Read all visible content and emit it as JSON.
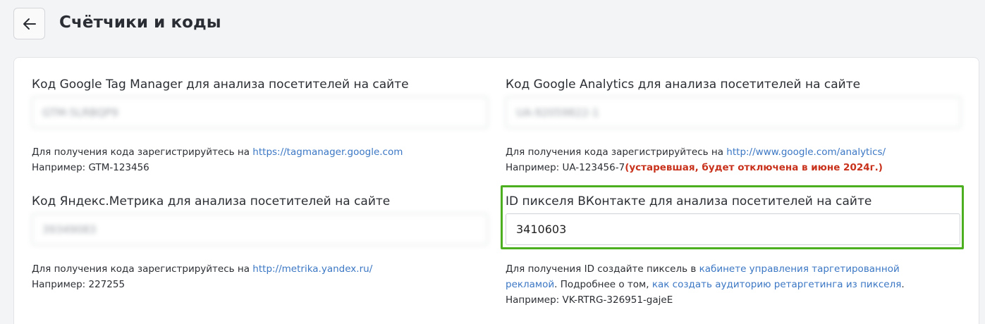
{
  "header": {
    "title": "Счётчики и коды"
  },
  "fields": {
    "gtm": {
      "label": "Код Google Tag Manager для анализа посетителей на сайте",
      "value": "GTM-5LRBQP9",
      "hint_prefix": "Для получения кода зарегистрируйтесь на ",
      "hint_link": "https://tagmanager.google.com",
      "example": "Например: GTM-123456"
    },
    "ga": {
      "label": "Код Google Analytics для анализа посетителей на сайте",
      "value": "UA-92059822-1",
      "hint_prefix": "Для получения кода зарегистрируйтесь на ",
      "hint_link": "http://www.google.com/analytics/",
      "example": "Например: UA-123456-7",
      "warning": "(устаревшая, будет отключена в июне 2024г.)"
    },
    "yandex": {
      "label": "Код Яндекс.Метрика для анализа посетителей на сайте",
      "value": "39349083",
      "hint_prefix": "Для получения кода зарегистрируйтесь на ",
      "hint_link": "http://metrika.yandex.ru/",
      "example": "Например: 227255"
    },
    "vk": {
      "label": "ID пикселя ВКонтакте для анализа посетителей на сайте",
      "value": "3410603",
      "hint_prefix": "Для получения ID создайте пиксель в ",
      "hint_link1": "кабинете управления таргетированной",
      "hint_link1b": "рекламой",
      "hint_middle": ". Подробнее о том, ",
      "hint_link2": "как создать аудиторию ретаргетинга из пикселя",
      "hint_end": ".",
      "example": "Например: VK-RTRG-326951-gajeE"
    }
  },
  "colors": {
    "highlight": "#4caf1f",
    "link": "#3b77c4",
    "warning": "#c8321c"
  }
}
